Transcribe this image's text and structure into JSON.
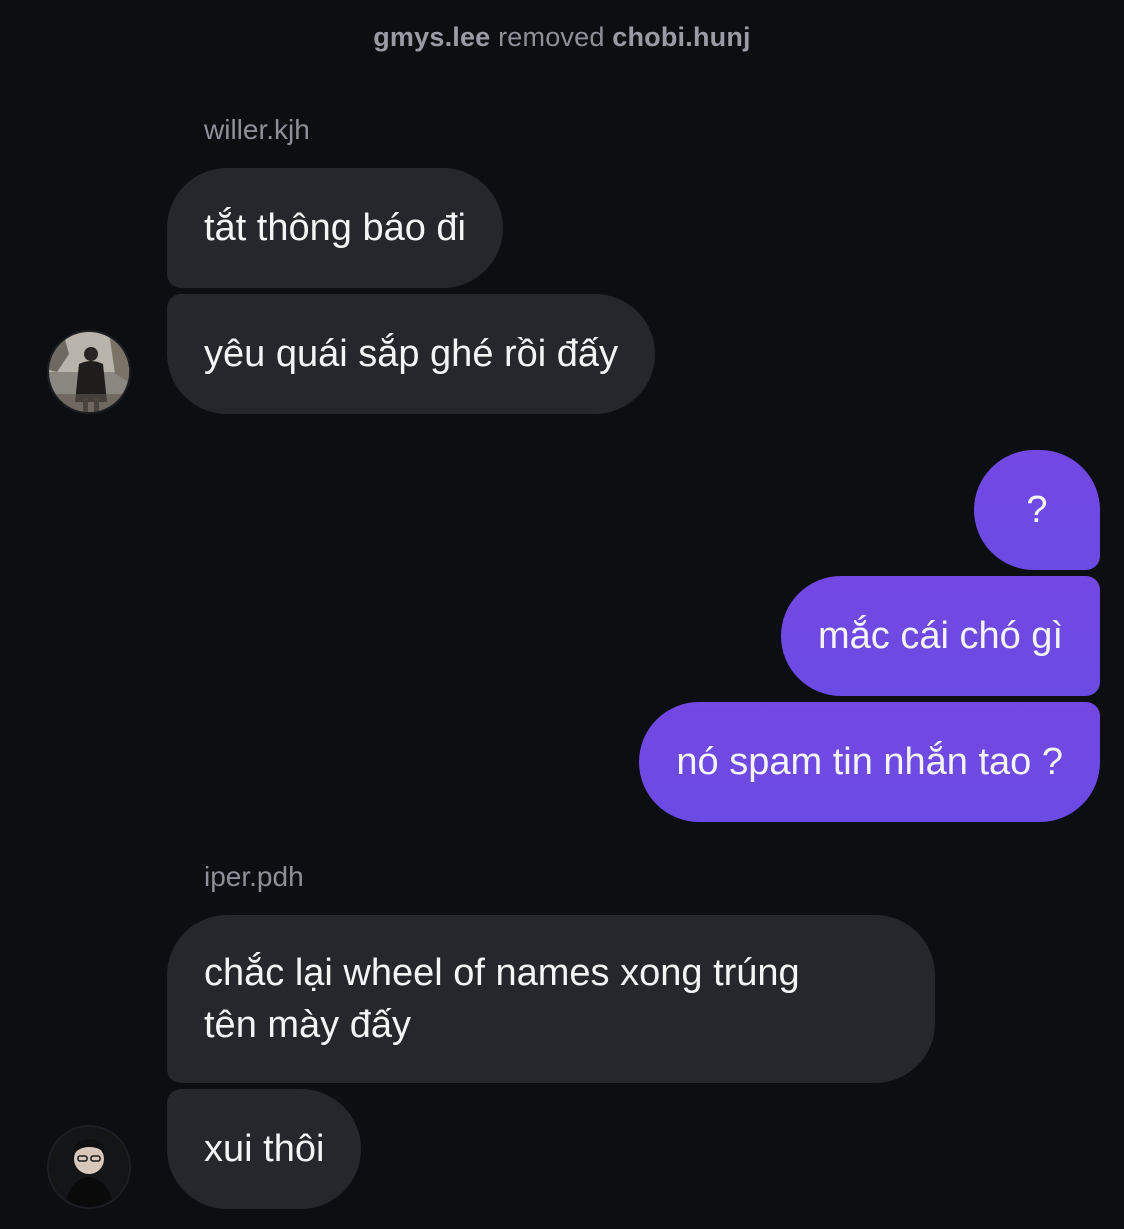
{
  "system_message": {
    "actor": "gmys.lee",
    "action": "removed",
    "target": "chobi.hunj"
  },
  "groups": [
    {
      "sender": "willer.kjh",
      "messages": [
        "tắt thông báo đi",
        "yêu quái sắp ghé rồi đấy"
      ]
    },
    {
      "sender": "",
      "messages": [
        "?",
        "mắc cái chó gì",
        "nó spam tin nhắn tao ?"
      ]
    },
    {
      "sender": "iper.pdh",
      "messages": [
        "chắc lại wheel of names xong trúng",
        "tên mày đấy",
        "xui thôi"
      ]
    }
  ],
  "colors": {
    "background": "#0c0e12",
    "incoming_bubble": "#25272c",
    "outgoing_bubble": "#7048e2",
    "muted_text": "#8e9099"
  },
  "icons": {
    "avatar_1": "user-photo-avatar-icon",
    "avatar_2": "user-photo-avatar-icon"
  }
}
